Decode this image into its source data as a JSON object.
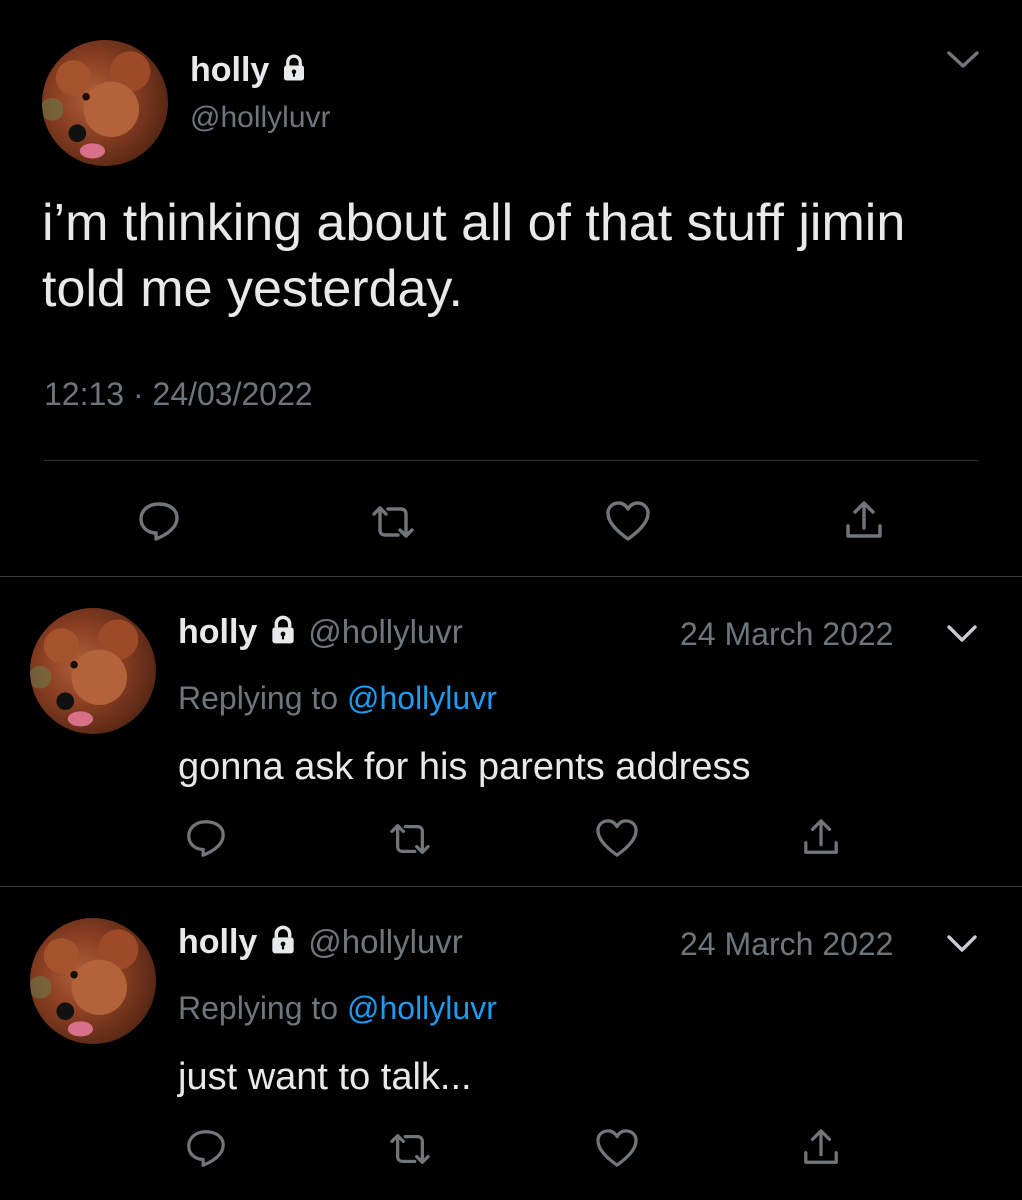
{
  "main_tweet": {
    "display_name": "holly",
    "handle": "@hollyluvr",
    "text": "i’m thinking about all of that stuff jimin told me yesterday.",
    "time": "12:13",
    "separator": "·",
    "date": "24/03/2022"
  },
  "replies": [
    {
      "display_name": "holly",
      "handle": "@hollyluvr",
      "date": "24 March 2022",
      "replying_prefix": "Replying to",
      "replying_to": "@hollyluvr",
      "text": "gonna ask for his parents address"
    },
    {
      "display_name": "holly",
      "handle": "@hollyluvr",
      "date": "24 March 2022",
      "replying_prefix": "Replying to",
      "replying_to": "@hollyluvr",
      "text": "just want to talk..."
    }
  ],
  "icons": {
    "reply": "reply-icon",
    "retweet": "retweet-icon",
    "like": "heart-icon",
    "share": "share-icon",
    "lock": "lock-icon",
    "more": "chevron-down-icon"
  },
  "colors": {
    "background": "#000000",
    "text": "#e7e9ea",
    "muted": "#6e767d",
    "link": "#1d9bf0",
    "divider": "#2f3336"
  }
}
